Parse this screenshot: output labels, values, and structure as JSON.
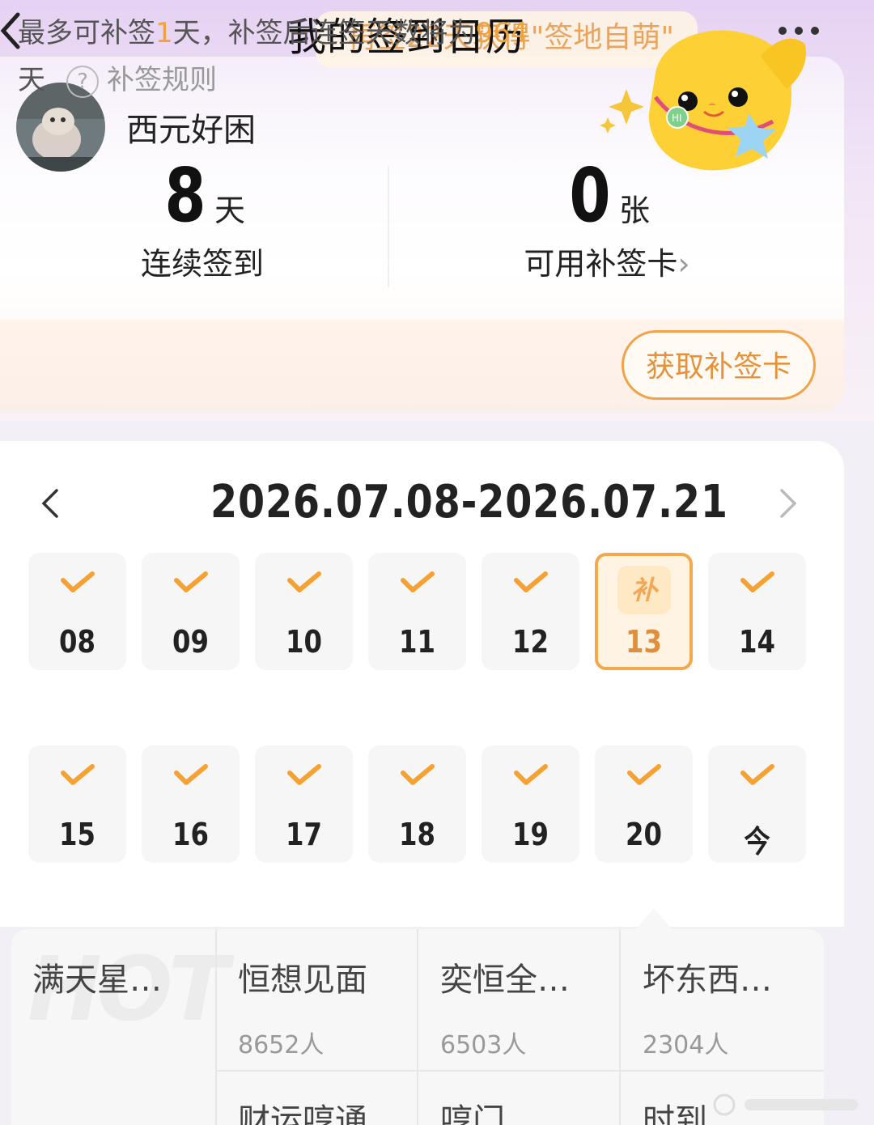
{
  "header": {
    "title": "我的签到日历",
    "banner_text": "再签22天获得\"签地自萌\""
  },
  "user": {
    "name": "西元好困"
  },
  "stats": {
    "streak_value": "8",
    "streak_unit": "天",
    "streak_label": "连续签到",
    "cards_value": "0",
    "cards_unit": "张",
    "cards_label": "可用补签卡",
    "cards_chevron": "›"
  },
  "makeup": {
    "text_part1": "最多可补签",
    "days": "1",
    "text_part2": "天，补签后连签天数将为",
    "total": "964",
    "text_part3": "天",
    "help_glyph": "?",
    "rule_label": "补签规则",
    "button_label": "获取补签卡"
  },
  "calendar": {
    "range": "2026.07.08-2026.07.21",
    "makeup_badge": "补",
    "days": [
      {
        "label": "08",
        "checked": true
      },
      {
        "label": "09",
        "checked": true
      },
      {
        "label": "10",
        "checked": true
      },
      {
        "label": "11",
        "checked": true
      },
      {
        "label": "12",
        "checked": true
      },
      {
        "label": "13",
        "checked": false,
        "makeup": true
      },
      {
        "label": "14",
        "checked": true
      },
      {
        "label": "15",
        "checked": true
      },
      {
        "label": "16",
        "checked": true
      },
      {
        "label": "17",
        "checked": true
      },
      {
        "label": "18",
        "checked": true
      },
      {
        "label": "19",
        "checked": true
      },
      {
        "label": "20",
        "checked": true
      },
      {
        "label": "今",
        "checked": true
      }
    ]
  },
  "topics": {
    "hot_watermark": "HOT",
    "items": [
      {
        "name": "满天星…",
        "count": ""
      },
      {
        "name": "恒想见面",
        "count": "8652人"
      },
      {
        "name": "奕恒全…",
        "count": "6503人"
      },
      {
        "name": "坏东西…",
        "count": "2304人"
      },
      {
        "name": "财运哼通",
        "count": ""
      },
      {
        "name": "哼门",
        "count": ""
      },
      {
        "name": "时到",
        "count": ""
      }
    ]
  },
  "colors": {
    "accent": "#f2a23c",
    "check": "#f5a233",
    "makeup_border": "#f2a84c"
  }
}
